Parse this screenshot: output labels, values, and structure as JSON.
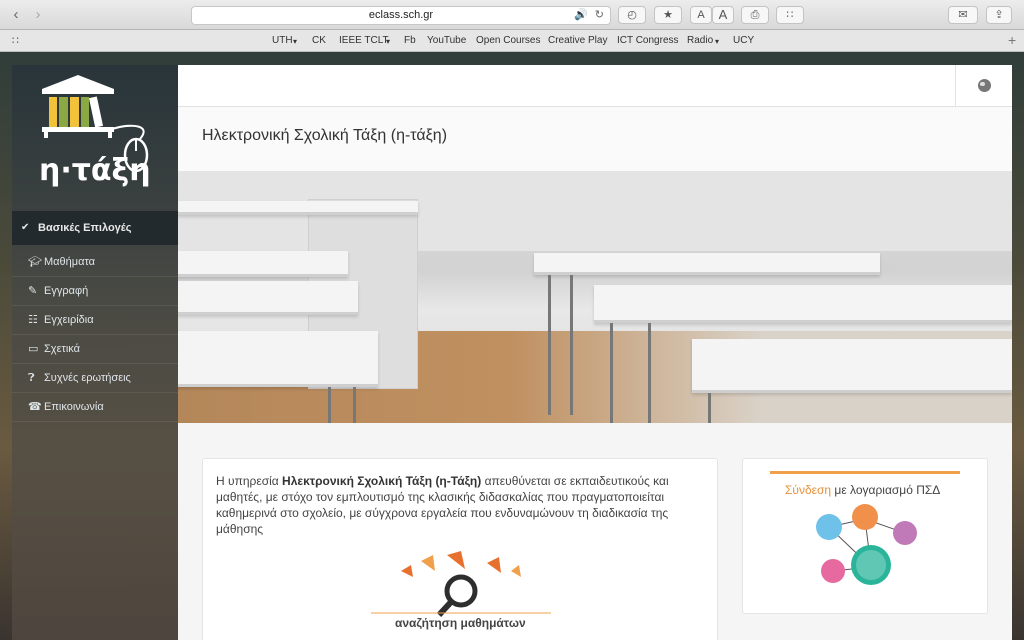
{
  "browser": {
    "url": "eclass.sch.gr",
    "bookmarks": [
      "UTH",
      "CK",
      "IEEE TCLT",
      "Fb",
      "YouTube",
      "Open Courses",
      "Creative Play",
      "ICT Congress",
      "Radio",
      "UCY"
    ]
  },
  "sidebar": {
    "logo_text": "η·τάξη",
    "section_title": "Βασικές Επιλογές",
    "items": [
      {
        "label": "Μαθήματα",
        "icon": "graduation-cap-icon"
      },
      {
        "label": "Εγγραφή",
        "icon": "edit-icon"
      },
      {
        "label": "Εγχειρίδια",
        "icon": "document-icon"
      },
      {
        "label": "Σχετικά",
        "icon": "credit-card-icon"
      },
      {
        "label": "Συχνές ερωτήσεις",
        "icon": "question-icon"
      },
      {
        "label": "Επικοινωνία",
        "icon": "phone-icon"
      }
    ]
  },
  "main": {
    "page_title": "Ηλεκτρονική Σχολική Τάξη (η-τάξη)",
    "intro_prefix": "Η υπηρεσία ",
    "intro_bold": "Ηλεκτρονική Σχολική Τάξη (η-Τάξη)",
    "intro_suffix": " απευθύνεται σε εκπαιδευτικούς και μαθητές, με στόχο τον εμπλουτισμό της κλασικής διδασκαλίας που πραγματοποιείται καθημερινά στο σχολείο, με σύγχρονα εργαλεία που ενδυναμώνουν τη διαδικασία της μάθησης",
    "search_label": "αναζήτηση μαθημάτων",
    "login_highlight": "Σύνδεση",
    "login_rest": " με λογαριασμό ΠΣΔ"
  },
  "colors": {
    "accent_orange": "#f0a04b",
    "sidebar_dark": "#28343a"
  }
}
